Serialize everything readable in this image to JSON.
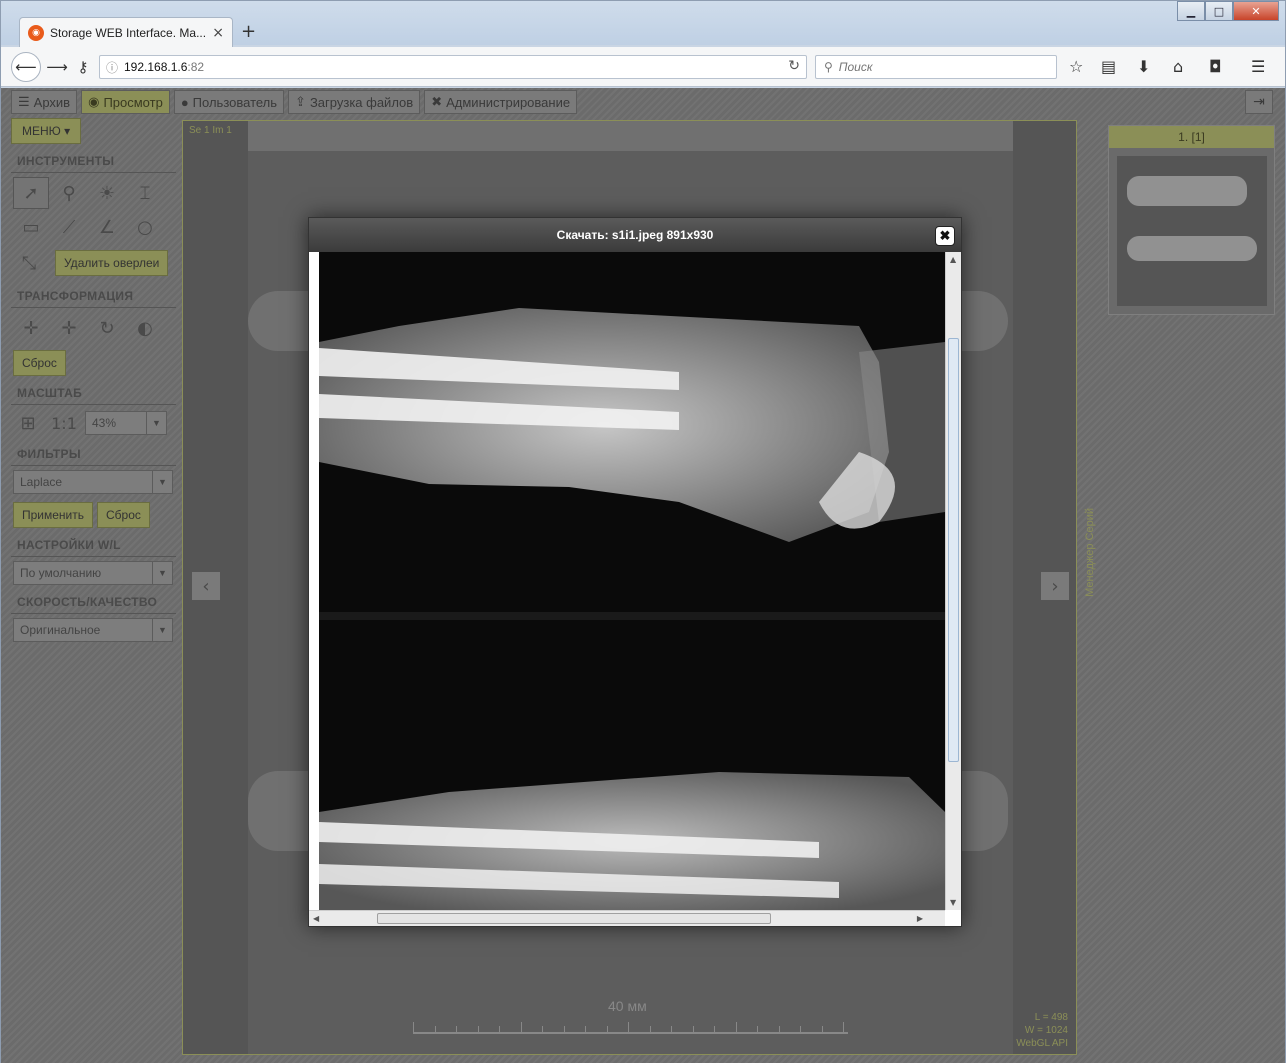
{
  "browser": {
    "tab_title": "Storage WEB Interface. Ma...",
    "tab_close": "×",
    "new_tab": "+",
    "url_host": "192.168.1.6",
    "url_port": ":82",
    "search_placeholder": "Поиск",
    "window_minimize": "▁",
    "window_maximize": "□",
    "window_close": "✕"
  },
  "topmenu": {
    "items": [
      {
        "label": "Архив",
        "icon": "list-icon"
      },
      {
        "label": "Просмотр",
        "icon": "eye-icon"
      },
      {
        "label": "Пользователь",
        "icon": "user-icon"
      },
      {
        "label": "Загрузка файлов",
        "icon": "upload-icon"
      },
      {
        "label": "Администрирование",
        "icon": "wrench-icon"
      }
    ]
  },
  "sidebar": {
    "menu_label": "МЕНЮ ▾",
    "tools_title": "ИНСТРУМЕНТЫ",
    "remove_overlay_label": "Удалить оверлеи",
    "transform_title": "ТРАНСФОРМАЦИЯ",
    "reset_label": "Сброс",
    "scale_title": "МАСШТАБ",
    "scale_one_to_one": "1:1",
    "scale_value": "43%",
    "filters_title": "ФИЛЬТРЫ",
    "filter_value": "Laplace",
    "apply_label": "Применить",
    "filter_reset_label": "Сброс",
    "wl_title": "НАСТРОЙКИ W/L",
    "wl_value": "По умолчанию",
    "speed_title": "СКОРОСТЬ/КАЧЕСТВО",
    "speed_value": "Оригинальное"
  },
  "viewer": {
    "series_label": "Se 1 Im 1",
    "ruler_label": "40 мм",
    "wl_l": "L = 498",
    "wl_w": "W = 1024",
    "renderer": "WebGL API"
  },
  "series_manager": {
    "label": "Менеджер Серий",
    "thumb_title": "1. [1]"
  },
  "modal": {
    "title": "Скачать: s1i1.jpeg 891x930",
    "close": "✖"
  }
}
